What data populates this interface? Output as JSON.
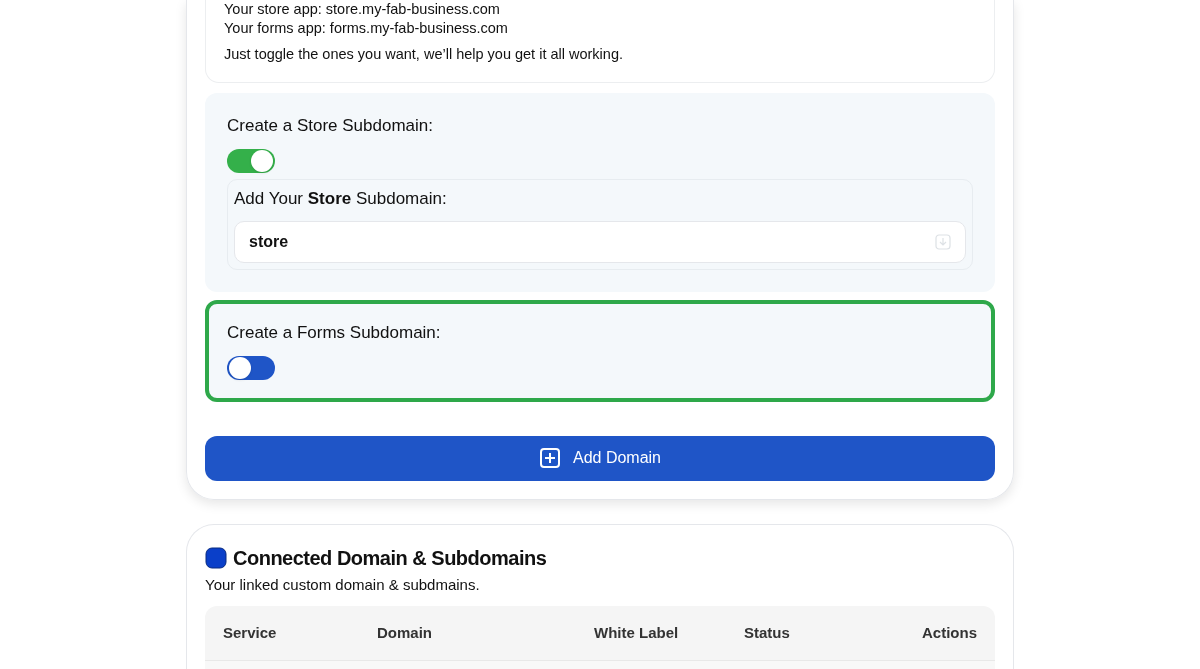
{
  "intro": {
    "lines": [
      "Your store app: store.my-fab-business.com",
      "Your forms app: forms.my-fab-business.com"
    ],
    "note": "Just toggle the ones you want, we’ll help you get it all working."
  },
  "subdomains": [
    {
      "label": "Create a Store Subdomain:",
      "on": true,
      "highlighted": false,
      "field": {
        "label": "Add Your **Store** Subdomain:",
        "value": "store"
      }
    },
    {
      "label": "Create a Forms Subdomain:",
      "on": false,
      "highlighted": true
    }
  ],
  "add_button": "Add Domain",
  "connected": {
    "title": "Connected Domain & Subdomains",
    "subtitle": "Your linked custom domain & subdmains.",
    "columns": [
      "Service",
      "Domain",
      "White Label",
      "Status",
      "Actions"
    ]
  }
}
